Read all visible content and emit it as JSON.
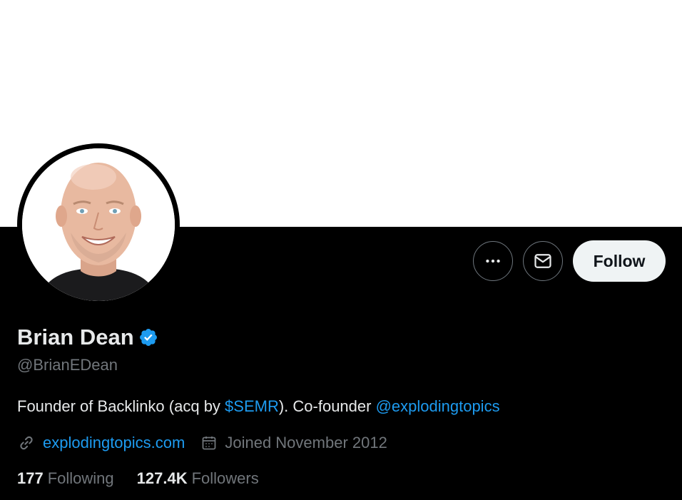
{
  "profile": {
    "display_name": "Brian Dean",
    "handle": "@BrianEDean",
    "bio": {
      "part1": "Founder of Backlinko (acq by ",
      "link1": "$SEMR",
      "part2": "). Co-founder ",
      "link2": "@explodingtopics"
    },
    "website": "explodingtopics.com",
    "joined": "Joined November 2012",
    "following_count": "177",
    "following_label": "Following",
    "followers_count": "127.4K",
    "followers_label": "Followers"
  },
  "actions": {
    "more_icon": "more-horizontal-icon",
    "message_icon": "envelope-icon",
    "follow_label": "Follow"
  },
  "icons": {
    "verified": "verified-badge-icon",
    "link": "link-icon",
    "calendar": "calendar-icon"
  },
  "colors": {
    "background": "#000000",
    "banner": "#ffffff",
    "accent": "#1d9bf0",
    "text_primary": "#e7e9ea",
    "text_secondary": "#71767b",
    "follow_button": "#eff3f4"
  }
}
